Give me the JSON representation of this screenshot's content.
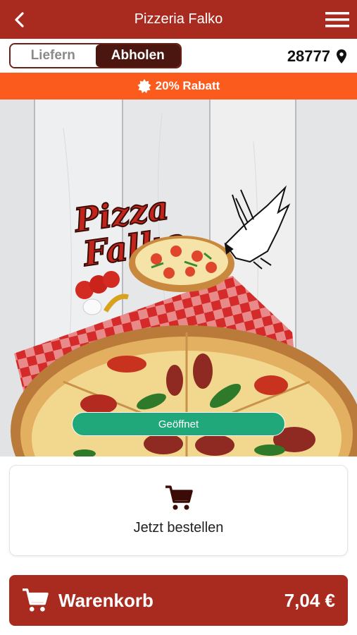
{
  "header": {
    "title": "Pizzeria Falko",
    "back_icon": "chevron-left-icon",
    "menu_icon": "hamburger-menu-icon"
  },
  "mode_toggle": {
    "options": [
      "Liefern",
      "Abholen"
    ],
    "selected": "Abholen"
  },
  "location": {
    "zip": "28777",
    "icon": "location-pin-icon"
  },
  "promo": {
    "icon": "badge-star-icon",
    "text": "20% Rabatt"
  },
  "hero": {
    "logo_line1": "Pizza",
    "logo_line2": "Falko",
    "status": "Geöffnet"
  },
  "order_card": {
    "icon": "shopping-cart-icon",
    "label": "Jetzt bestellen"
  },
  "cart": {
    "icon": "shopping-cart-icon",
    "label": "Warenkorb",
    "total": "7,04 €"
  },
  "colors": {
    "brand_red": "#a92b20",
    "dark_brown": "#4a160f",
    "promo_orange": "#fb5c1d",
    "open_green": "#20a87a"
  }
}
